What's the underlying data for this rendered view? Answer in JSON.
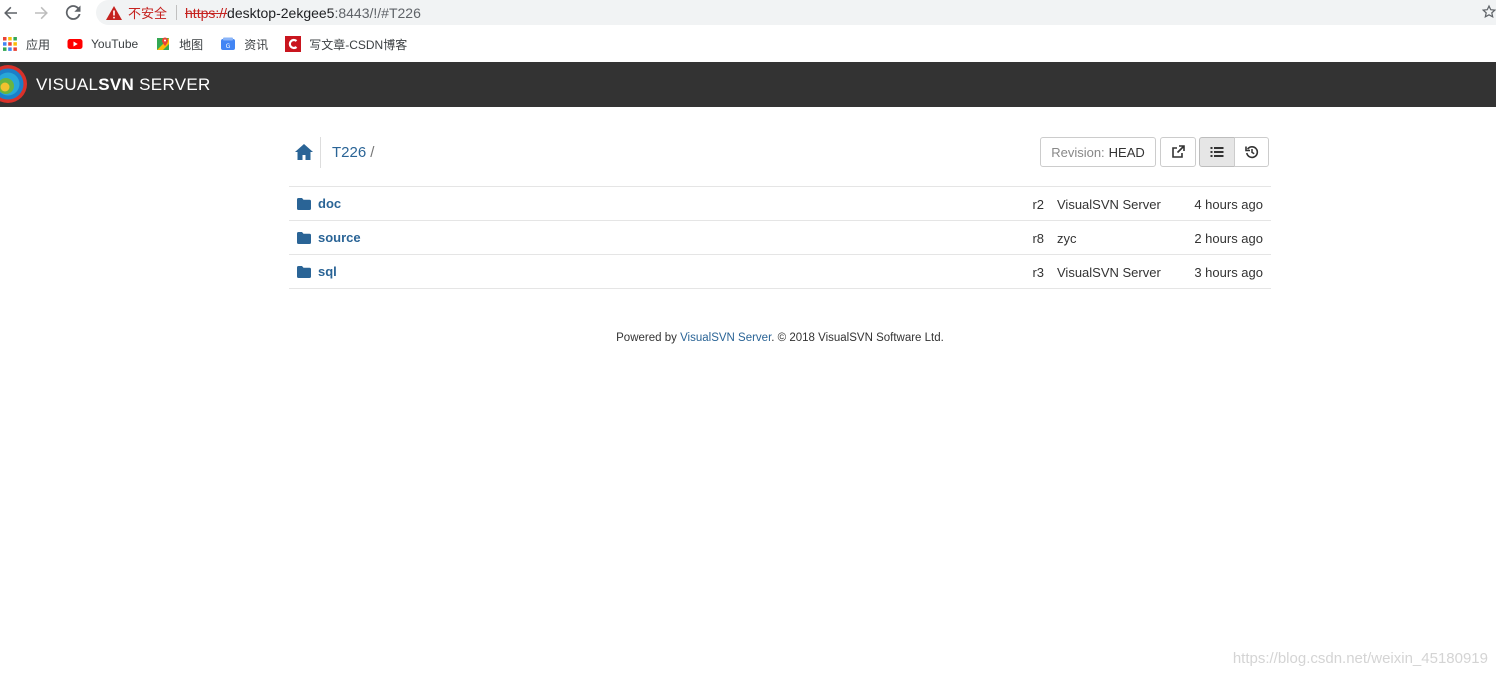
{
  "browser": {
    "insecure_label": "不安全",
    "url_scheme": "https://",
    "url_host": "desktop-2ekgee5",
    "url_rest": ":8443/!/#T226",
    "bookmarks": [
      {
        "label": "应用",
        "icon": "apps-grid-icon"
      },
      {
        "label": "YouTube",
        "icon": "youtube-icon"
      },
      {
        "label": "地图",
        "icon": "maps-icon"
      },
      {
        "label": "资讯",
        "icon": "news-icon"
      },
      {
        "label": "写文章-CSDN博客",
        "icon": "csdn-icon"
      }
    ]
  },
  "header": {
    "brand_light": "VISUAL",
    "brand_bold": "SVN",
    "brand_tail": " SERVER",
    "bg_color": "#333333"
  },
  "breadcrumb": {
    "repo": "T226",
    "slash": "/"
  },
  "toolbar": {
    "revision_label": "Revision:",
    "revision_value": "HEAD"
  },
  "entries": [
    {
      "name": "doc",
      "rev": "r2",
      "author": "VisualSVN Server",
      "time": "4 hours ago"
    },
    {
      "name": "source",
      "rev": "r8",
      "author": "zyc",
      "time": "2 hours ago"
    },
    {
      "name": "sql",
      "rev": "r3",
      "author": "VisualSVN Server",
      "time": "3 hours ago"
    }
  ],
  "footer": {
    "prefix": "Powered by ",
    "link": "VisualSVN Server",
    "suffix": ". © 2018 VisualSVN Software Ltd."
  },
  "watermark": "https://blog.csdn.net/weixin_45180919",
  "colors": {
    "link": "#2a6496",
    "insecure": "#c5221f"
  }
}
